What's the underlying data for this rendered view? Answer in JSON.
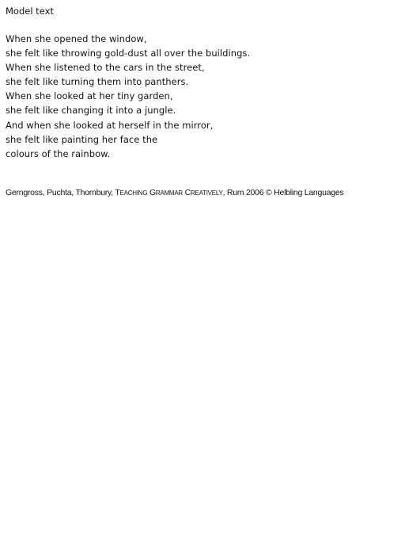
{
  "heading": "Model text",
  "poem": {
    "lines": [
      "When she opened the window,",
      "she felt like throwing gold-dust all over the buildings.",
      "When she listened to the cars in the street,",
      "she felt like turning them into panthers.",
      "When she looked at her tiny garden,",
      "she felt like changing it into a jungle.",
      "And when she looked at herself in the mirror,",
      "she felt like painting her face the",
      "colours of the rainbow."
    ]
  },
  "credit": {
    "authors": "Gerngross, Puchta, Thornbury, ",
    "book_title": "TEACHING GRAMMAR CREATIVELY",
    "publisher": ", Rum 2006 © Helbling Languages"
  }
}
